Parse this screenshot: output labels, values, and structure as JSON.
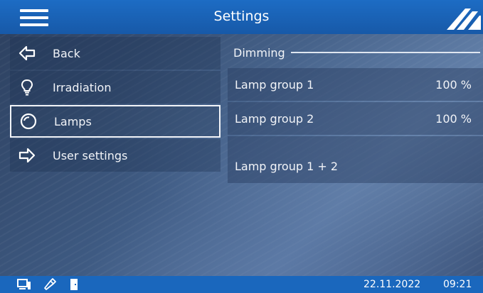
{
  "header": {
    "title": "Settings",
    "menu_icon": "hamburger-icon",
    "logo": "brand-logo"
  },
  "sidebar": {
    "items": [
      {
        "label": "Back",
        "icon": "arrow-left-icon"
      },
      {
        "label": "Irradiation",
        "icon": "lightbulb-icon"
      },
      {
        "label": "Lamps",
        "icon": "lamp-circle-icon",
        "selected": true
      },
      {
        "label": "User settings",
        "icon": "arrow-right-icon"
      }
    ]
  },
  "main": {
    "section_title": "Dimming",
    "rows": [
      {
        "label": "Lamp group 1",
        "value": "100 %"
      },
      {
        "label": "Lamp group 2",
        "value": "100 %"
      },
      {
        "label": "Lamp group 1 + 2",
        "value": ""
      }
    ]
  },
  "statusbar": {
    "date": "22.11.2022",
    "time": "09:21",
    "icons": [
      "monitor-icon",
      "usb-icon",
      "door-icon"
    ]
  },
  "colors": {
    "header_bg": "#1d6cc4",
    "statusbar_bg": "#1a67bd",
    "text": "#f2f4f8"
  }
}
